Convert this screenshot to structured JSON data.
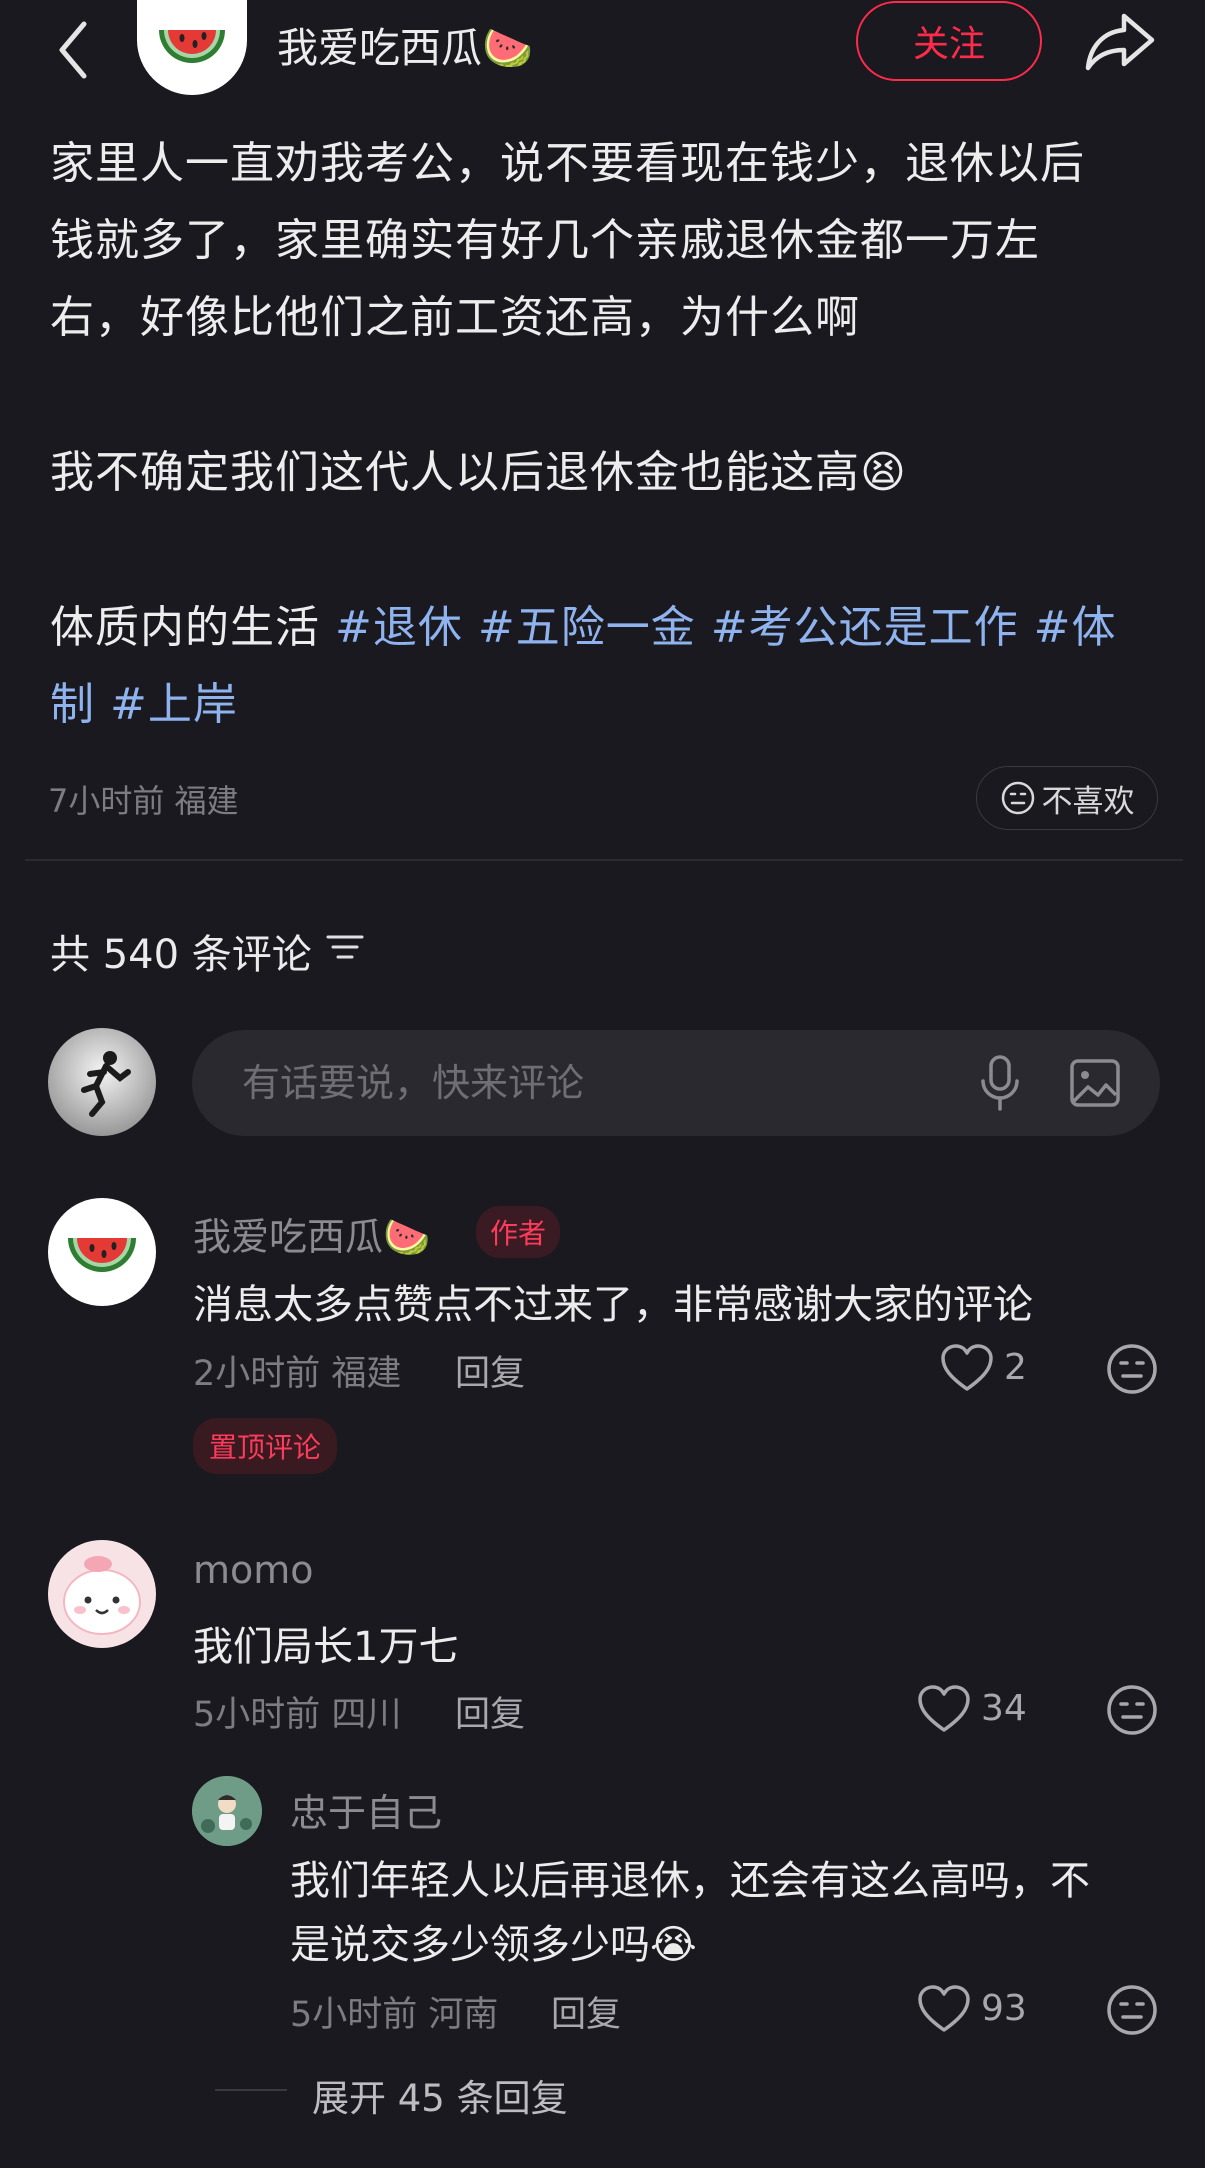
{
  "header": {
    "author_name": "我爱吃西瓜🍉",
    "follow_label": "关注"
  },
  "post": {
    "lines": [
      "家里人一直劝我考公，说不要看现在钱少，退休以后",
      "钱就多了，家里确实有好几个亲戚退休金都一万左",
      "右，好像比他们之前工资还高，为什么啊",
      "我不确定我们这代人以后退休金也能这高😫"
    ],
    "tag_prefix": "体质内的生活 ",
    "tags": [
      "#退休",
      "#五险一金",
      "#考公还是工作",
      "#体",
      "制",
      "#上岸"
    ],
    "meta": "7小时前  福建",
    "dislike_label": "不喜欢"
  },
  "comments_header": {
    "count_label": "共 540 条评论"
  },
  "comment_input": {
    "placeholder": "有话要说，快来评论"
  },
  "comments": [
    {
      "name": "我爱吃西瓜🍉",
      "badge": "作者",
      "text": "消息太多点赞点不过来了，非常感谢大家的评论",
      "meta": "2小时前  福建",
      "reply_label": "回复",
      "likes": "2",
      "pinned_label": "置顶评论"
    },
    {
      "name": "momo",
      "text": "我们局长1万七",
      "meta": "5小时前  四川",
      "reply_label": "回复",
      "likes": "34",
      "replies": [
        {
          "name": "忠于自己",
          "text_lines": [
            "我们年轻人以后再退休，还会有这么高吗，不",
            "是说交多少领多少吗😭"
          ],
          "meta": "5小时前  河南",
          "reply_label": "回复",
          "likes": "93"
        }
      ],
      "expand_label": "展开 45 条回复"
    }
  ],
  "colors": {
    "background": "#1a191f",
    "accent": "#ff2b4b",
    "hashtag": "#8fb3ee"
  }
}
